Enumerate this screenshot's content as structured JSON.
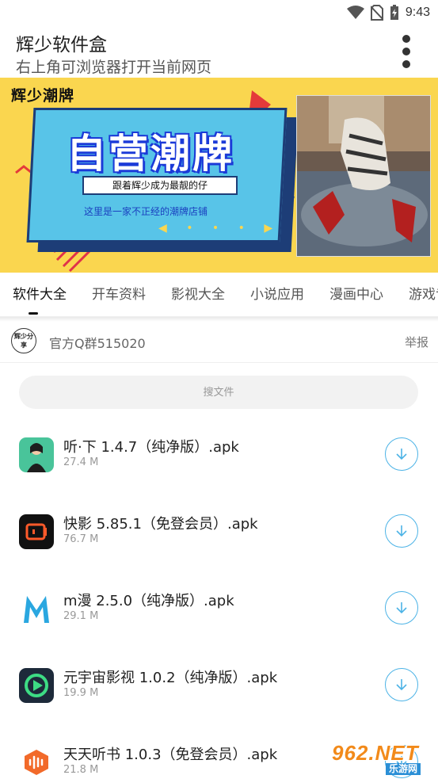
{
  "status_bar": {
    "time": "9:43"
  },
  "header": {
    "title": "辉少软件盒",
    "subtitle": "右上角可浏览器打开当前网页"
  },
  "banner": {
    "brand": "辉少潮牌",
    "headline": "自营潮牌",
    "tagline": "跟着辉少成为最靓的仔",
    "line2": "这里是一家不正经的潮牌店铺",
    "arrows": "◀ • • • ▶"
  },
  "tabs": [
    {
      "label": "软件大全",
      "active": true
    },
    {
      "label": "开车资料"
    },
    {
      "label": "影视大全"
    },
    {
      "label": "小说应用"
    },
    {
      "label": "漫画中心"
    },
    {
      "label": "游戏专"
    }
  ],
  "group": {
    "avatar_text": "辉少分享",
    "name": "官方Q群515020",
    "report_label": "举报"
  },
  "search": {
    "placeholder": "搜文件"
  },
  "files": [
    {
      "name": "听·下 1.4.7（纯净版）.apk",
      "size": "27.4 M",
      "icon": "ting-xia-app-icon",
      "color": "#3dba8a"
    },
    {
      "name": "快影 5.85.1（免登会员）.apk",
      "size": "76.7 M",
      "icon": "kuaiying-app-icon",
      "color": "#111111"
    },
    {
      "name": "m漫 2.5.0（纯净版）.apk",
      "size": "29.1 M",
      "icon": "m-man-app-icon",
      "color": "#2aa7e0"
    },
    {
      "name": "元宇宙影视 1.0.2（纯净版）.apk",
      "size": "19.9 M",
      "icon": "yuanyuzhou-app-icon",
      "color": "#1d2a3a"
    },
    {
      "name": "天天听书 1.0.3（免登会员）.apk",
      "size": "21.8 M",
      "icon": "tiantian-tingshu-app-icon",
      "color": "#f26a2a"
    }
  ],
  "watermark": {
    "main": "962.NET",
    "sub": "乐游网"
  }
}
